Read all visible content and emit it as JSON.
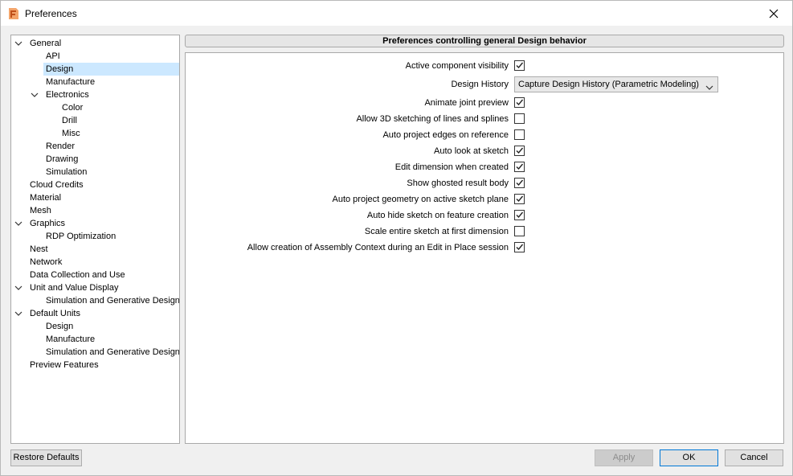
{
  "window": {
    "title": "Preferences"
  },
  "tree": {
    "items": [
      {
        "label": "General",
        "level": 0,
        "expanded": true
      },
      {
        "label": "API",
        "level": 1
      },
      {
        "label": "Design",
        "level": 1,
        "selected": true
      },
      {
        "label": "Manufacture",
        "level": 1
      },
      {
        "label": "Electronics",
        "level": 1,
        "expanded": true
      },
      {
        "label": "Color",
        "level": 2
      },
      {
        "label": "Drill",
        "level": 2
      },
      {
        "label": "Misc",
        "level": 2
      },
      {
        "label": "Render",
        "level": 1
      },
      {
        "label": "Drawing",
        "level": 1
      },
      {
        "label": "Simulation",
        "level": 1
      },
      {
        "label": "Cloud Credits",
        "level": 0
      },
      {
        "label": "Material",
        "level": 0
      },
      {
        "label": "Mesh",
        "level": 0
      },
      {
        "label": "Graphics",
        "level": 0,
        "expanded": true
      },
      {
        "label": "RDP Optimization",
        "level": 1
      },
      {
        "label": "Nest",
        "level": 0
      },
      {
        "label": "Network",
        "level": 0
      },
      {
        "label": "Data Collection and Use",
        "level": 0
      },
      {
        "label": "Unit and Value Display",
        "level": 0,
        "expanded": true
      },
      {
        "label": "Simulation and Generative Design",
        "level": 1
      },
      {
        "label": "Default Units",
        "level": 0,
        "expanded": true
      },
      {
        "label": "Design",
        "level": 1
      },
      {
        "label": "Manufacture",
        "level": 1
      },
      {
        "label": "Simulation and Generative Design",
        "level": 1
      },
      {
        "label": "Preview Features",
        "level": 0
      }
    ]
  },
  "panel": {
    "header": "Preferences controlling general Design behavior",
    "design_history": {
      "label": "Design History",
      "value": "Capture Design History (Parametric Modeling)"
    },
    "prefs": [
      {
        "label": "Active component visibility",
        "checked": true
      },
      {
        "label": "Animate joint preview",
        "checked": true
      },
      {
        "label": "Allow 3D sketching of lines and splines",
        "checked": false
      },
      {
        "label": "Auto project edges on reference",
        "checked": false
      },
      {
        "label": "Auto look at sketch",
        "checked": true
      },
      {
        "label": "Edit dimension when created",
        "checked": true
      },
      {
        "label": "Show ghosted result body",
        "checked": true
      },
      {
        "label": "Auto project geometry on active sketch plane",
        "checked": true
      },
      {
        "label": "Auto hide sketch on feature creation",
        "checked": true
      },
      {
        "label": "Scale entire sketch at first dimension",
        "checked": false
      },
      {
        "label": "Allow creation of Assembly Context during an Edit in Place session",
        "checked": true
      }
    ]
  },
  "buttons": {
    "restore_defaults": "Restore Defaults",
    "apply": "Apply",
    "ok": "OK",
    "cancel": "Cancel"
  },
  "colors": {
    "selection": "#cce8ff",
    "app_icon": "#e8772e",
    "focus": "#0078d7"
  }
}
